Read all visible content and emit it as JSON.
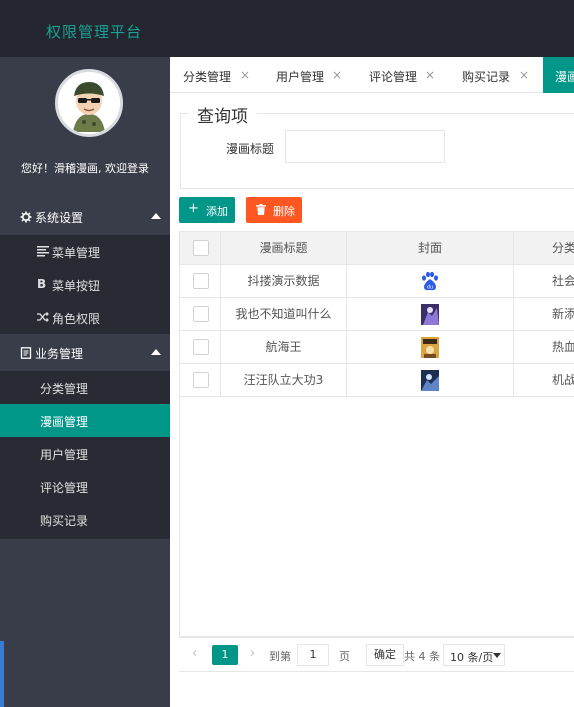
{
  "app": {
    "title": "权限管理平台"
  },
  "sidebar": {
    "welcome": "您好！滑稽漫画, 欢迎登录",
    "groups": [
      {
        "label": "系统设置",
        "icon": "gear-icon",
        "items": [
          {
            "label": "菜单管理",
            "icon": "list-icon"
          },
          {
            "label": "菜单按钮",
            "icon": "bold-b-icon"
          },
          {
            "label": "角色权限",
            "icon": "shuffle-icon"
          }
        ]
      },
      {
        "label": "业务管理",
        "icon": "document-icon",
        "items": [
          {
            "label": "分类管理"
          },
          {
            "label": "漫画管理",
            "active": true
          },
          {
            "label": "用户管理"
          },
          {
            "label": "评论管理"
          },
          {
            "label": "购买记录"
          }
        ]
      }
    ]
  },
  "tabs": [
    {
      "label": "分类管理",
      "close": "×"
    },
    {
      "label": "用户管理",
      "close": "×"
    },
    {
      "label": "评论管理",
      "close": "×"
    },
    {
      "label": "购买记录",
      "close": "×"
    },
    {
      "label": "漫画",
      "active": true
    }
  ],
  "query": {
    "legend": "查询项",
    "title_label": "漫画标题",
    "title_value": ""
  },
  "toolbar": {
    "add_label": "添加",
    "add_icon": "+",
    "delete_label": "删除"
  },
  "table": {
    "columns": [
      "漫画标题",
      "封面",
      "分类"
    ],
    "rows": [
      {
        "title": "抖搂演示数据",
        "cover": "baidu-logo-icon",
        "category": "社会"
      },
      {
        "title": "我也不知道叫什么",
        "cover": "cover-thumbnail-purple",
        "category": "新添加"
      },
      {
        "title": "航海王",
        "cover": "cover-thumbnail-yellow",
        "category": "热血"
      },
      {
        "title": "汪汪队立大功3",
        "cover": "cover-thumbnail-blue",
        "category": "机战"
      }
    ]
  },
  "pager": {
    "prev": "‹",
    "current": "1",
    "next": "›",
    "goto_label": "到第",
    "goto_value": "1",
    "page_unit": "页",
    "confirm": "确定",
    "total": "共 4 条",
    "page_size": "10 条/页"
  },
  "colors": {
    "accent": "#009688",
    "danger": "#ff5722",
    "header_bg": "#23262e",
    "sidebar_bg": "#393d49",
    "logo_text": "#1aa094"
  }
}
